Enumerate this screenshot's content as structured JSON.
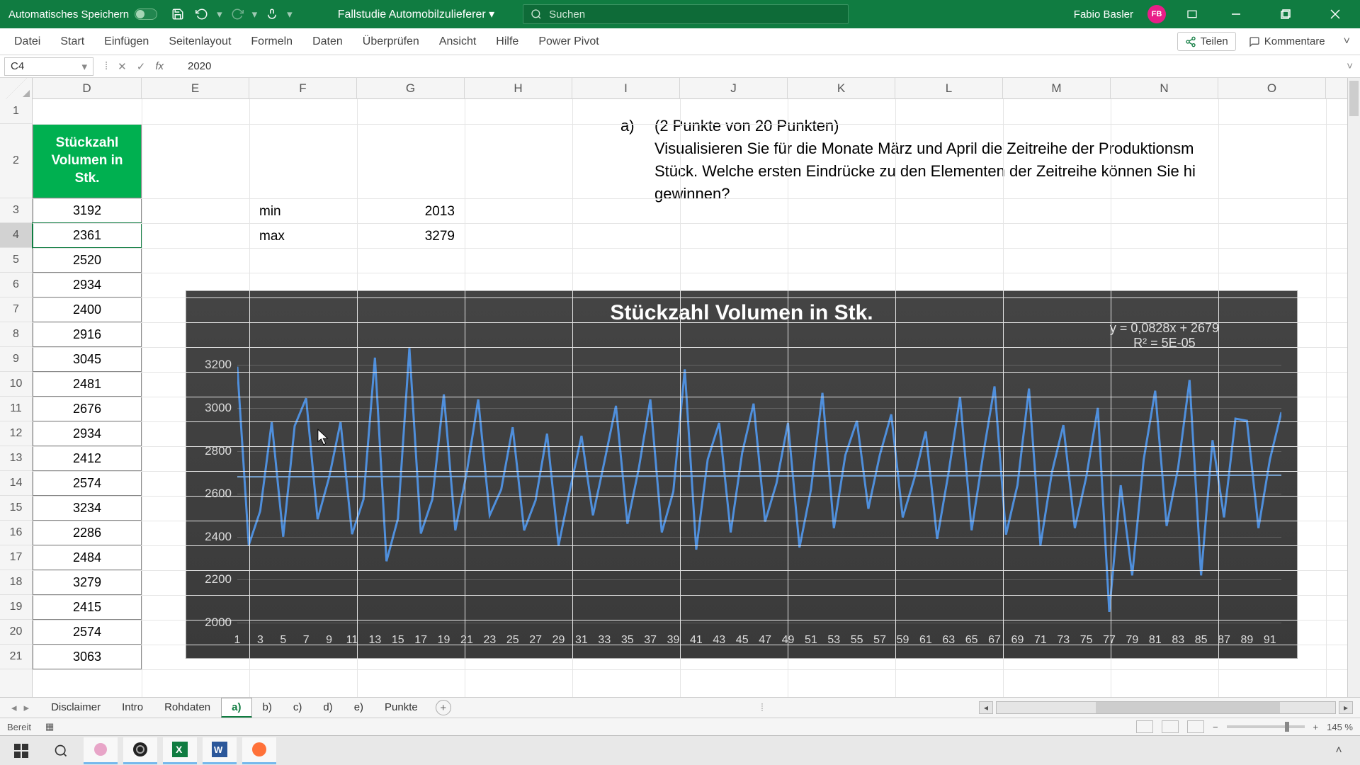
{
  "titlebar": {
    "autosave_label": "Automatisches Speichern",
    "doc_title": "Fallstudie Automobilzulieferer ▾",
    "search_placeholder": "Suchen",
    "user_name": "Fabio Basler",
    "user_initials": "FB"
  },
  "ribbon": {
    "tabs": [
      "Datei",
      "Start",
      "Einfügen",
      "Seitenlayout",
      "Formeln",
      "Daten",
      "Überprüfen",
      "Ansicht",
      "Hilfe",
      "Power Pivot"
    ],
    "share": "Teilen",
    "comments": "Kommentare"
  },
  "formula": {
    "cell_ref": "C4",
    "value": "2020"
  },
  "columns": {
    "widths": [
      154,
      152,
      152,
      152,
      152,
      152,
      152,
      152,
      152,
      152,
      152,
      152,
      152
    ],
    "labels": [
      "D",
      "E",
      "F",
      "G",
      "H",
      "I",
      "J",
      "K",
      "L",
      "M",
      "N",
      "O"
    ]
  },
  "rows": {
    "count": 21,
    "first_h": 35,
    "row2_h": 105
  },
  "data_header": "Stückzahl\nVolumen in\nStk.",
  "data_values": [
    3192,
    2361,
    2520,
    2934,
    2400,
    2916,
    3045,
    2481,
    2676,
    2934,
    2412,
    2574,
    3234,
    2286,
    2484,
    3279,
    2415,
    2574,
    3063
  ],
  "minmax": {
    "min_label": "min",
    "min_val": 2013,
    "max_label": "max",
    "max_val": 3279
  },
  "question": {
    "marker": "a)",
    "points": "(2 Punkte von 20 Punkten)",
    "line1": "Visualisieren Sie für die Monate März und April die Zeitreihe der Produktionsm",
    "line2": "Stück. Welche ersten Eindrücke zu den Elementen der Zeitreihe können Sie hi",
    "line3": "gewinnen?"
  },
  "chart_data": {
    "type": "line",
    "title": "Stückzahl Volumen in Stk.",
    "trend_eq": "y = 0,0828x + 2679",
    "trend_r2": "R² = 5E-05",
    "ylabel": "",
    "xlabel": "",
    "ylim": [
      2000,
      3280
    ],
    "yticks": [
      2000,
      2200,
      2400,
      2600,
      2800,
      3000,
      3200
    ],
    "xticks": [
      1,
      3,
      5,
      7,
      9,
      11,
      13,
      15,
      17,
      19,
      21,
      23,
      25,
      27,
      29,
      31,
      33,
      35,
      37,
      39,
      41,
      43,
      45,
      47,
      49,
      51,
      53,
      55,
      57,
      59,
      61,
      63,
      65,
      67,
      69,
      71,
      73,
      75,
      77,
      79,
      81,
      83,
      85,
      87,
      89,
      91
    ],
    "trendline": {
      "slope": 0.0828,
      "intercept": 2679
    },
    "x": [
      1,
      2,
      3,
      4,
      5,
      6,
      7,
      8,
      9,
      10,
      11,
      12,
      13,
      14,
      15,
      16,
      17,
      18,
      19,
      20,
      21,
      22,
      23,
      24,
      25,
      26,
      27,
      28,
      29,
      30,
      31,
      32,
      33,
      34,
      35,
      36,
      37,
      38,
      39,
      40,
      41,
      42,
      43,
      44,
      45,
      46,
      47,
      48,
      49,
      50,
      51,
      52,
      53,
      54,
      55,
      56,
      57,
      58,
      59,
      60,
      61,
      62,
      63,
      64,
      65,
      66,
      67,
      68,
      69,
      70,
      71,
      72,
      73,
      74,
      75,
      76,
      77,
      78,
      79,
      80,
      81,
      82,
      83,
      84,
      85,
      86,
      87,
      88,
      89,
      90,
      91,
      92
    ],
    "values": [
      3192,
      2361,
      2520,
      2934,
      2400,
      2916,
      3045,
      2481,
      2676,
      2934,
      2412,
      2574,
      3234,
      2286,
      2484,
      3279,
      2415,
      2574,
      3063,
      2430,
      2700,
      3040,
      2500,
      2620,
      2910,
      2430,
      2570,
      2880,
      2360,
      2620,
      2870,
      2500,
      2750,
      3010,
      2460,
      2720,
      3040,
      2420,
      2610,
      3180,
      2340,
      2760,
      2930,
      2420,
      2790,
      3020,
      2470,
      2650,
      2930,
      2350,
      2620,
      3070,
      2440,
      2780,
      2940,
      2530,
      2780,
      2970,
      2490,
      2670,
      2890,
      2390,
      2700,
      3050,
      2430,
      2780,
      3100,
      2410,
      2640,
      3090,
      2360,
      2700,
      2920,
      2440,
      2680,
      3000,
      2050,
      2640,
      2220,
      2760,
      3080,
      2450,
      2720,
      3130,
      2220,
      2850,
      2490,
      2950,
      2940,
      2440,
      2760,
      2980
    ],
    "colors": {
      "line": "#4f8fdc",
      "trend": "#7aa7d8"
    }
  },
  "sheet_tabs": [
    "Disclaimer",
    "Intro",
    "Rohdaten",
    "a)",
    "b)",
    "c)",
    "d)",
    "e)",
    "Punkte"
  ],
  "sheet_active": "a)",
  "status": {
    "ready": "Bereit",
    "zoom": "145 %"
  }
}
